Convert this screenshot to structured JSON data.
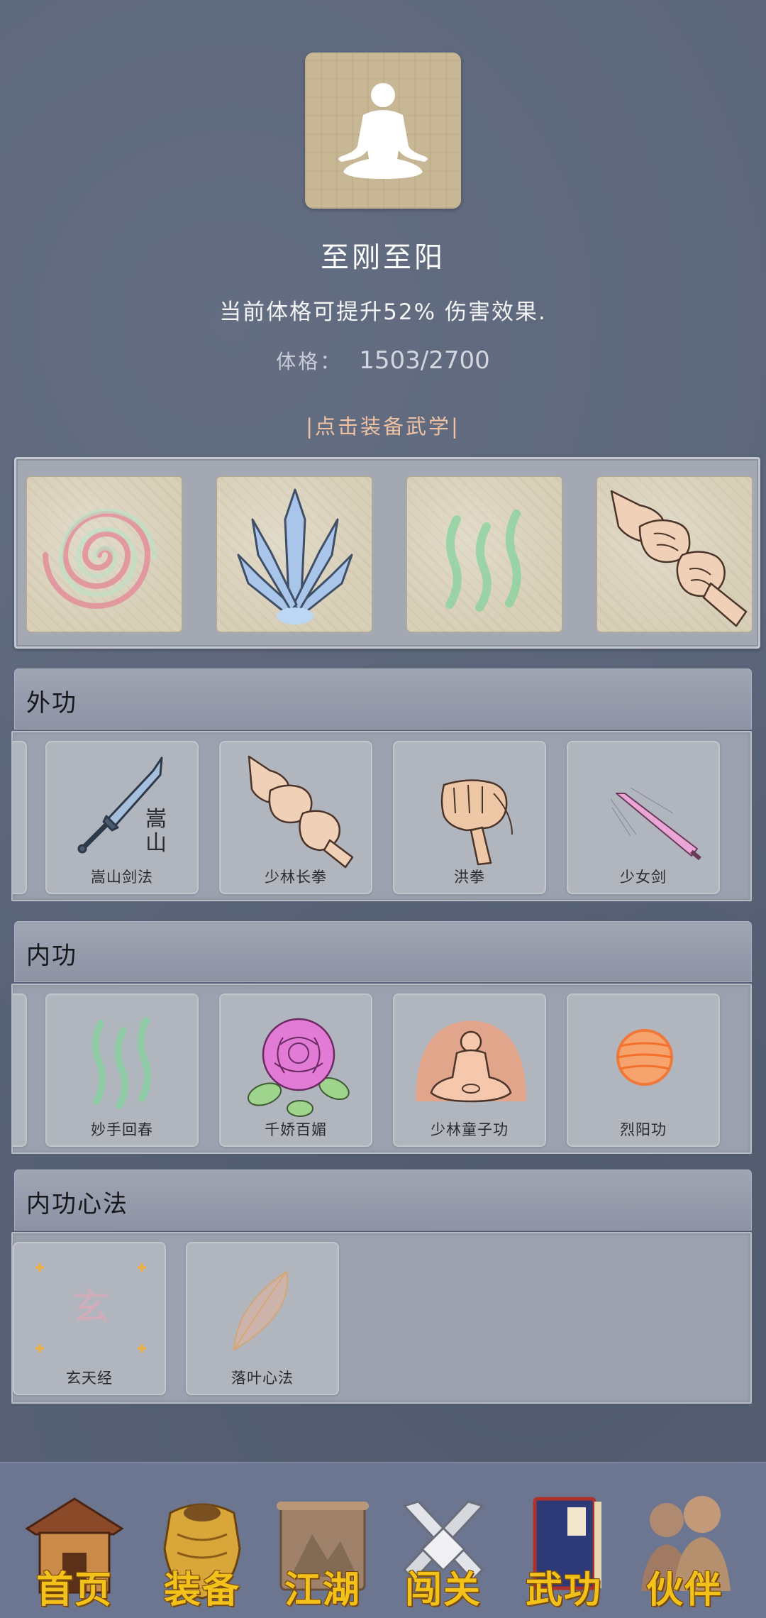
{
  "header": {
    "title": "至刚至阳",
    "description": "当前体格可提升52% 伤害效果.",
    "stat_label": "体格：",
    "stat_value": "1503/2700",
    "equip_hint": "|点击装备武学|"
  },
  "equipped_slots": [
    {
      "icon": "spiral-icon"
    },
    {
      "icon": "blades-icon"
    },
    {
      "icon": "qi-waves-icon"
    },
    {
      "icon": "fists-icon"
    }
  ],
  "external": {
    "title": "外功",
    "items": [
      {
        "name": "嵩山剑法",
        "icon": "sword-icon",
        "seal_top": "嵩",
        "seal_bottom": "山"
      },
      {
        "name": "少林长拳",
        "icon": "fists-icon"
      },
      {
        "name": "洪拳",
        "icon": "fist-icon"
      },
      {
        "name": "少女剑",
        "icon": "pink-sword-icon"
      }
    ]
  },
  "internal": {
    "title": "内功",
    "items": [
      {
        "name": "妙手回春",
        "icon": "qi-waves-icon"
      },
      {
        "name": "千娇百媚",
        "icon": "rose-icon"
      },
      {
        "name": "少林童子功",
        "icon": "meditation-icon"
      },
      {
        "name": "烈阳功",
        "icon": "sun-orb-icon"
      }
    ]
  },
  "heart_method": {
    "title": "内功心法",
    "items": [
      {
        "name": "玄天经",
        "icon": "xuan-seal-icon",
        "glyph": "玄"
      },
      {
        "name": "落叶心法",
        "icon": "leaf-icon"
      }
    ]
  },
  "nav": {
    "items": [
      {
        "label": "首页",
        "icon": "house-icon"
      },
      {
        "label": "装备",
        "icon": "armor-icon"
      },
      {
        "label": "江湖",
        "icon": "scroll-map-icon"
      },
      {
        "label": "闯关",
        "icon": "crossed-swords-icon"
      },
      {
        "label": "武功",
        "icon": "book-icon"
      },
      {
        "label": "伙伴",
        "icon": "companions-icon"
      }
    ]
  },
  "colors": {
    "background": "#5a6479",
    "hint": "#f0c2a4",
    "nav_label": "#f2c21b"
  }
}
